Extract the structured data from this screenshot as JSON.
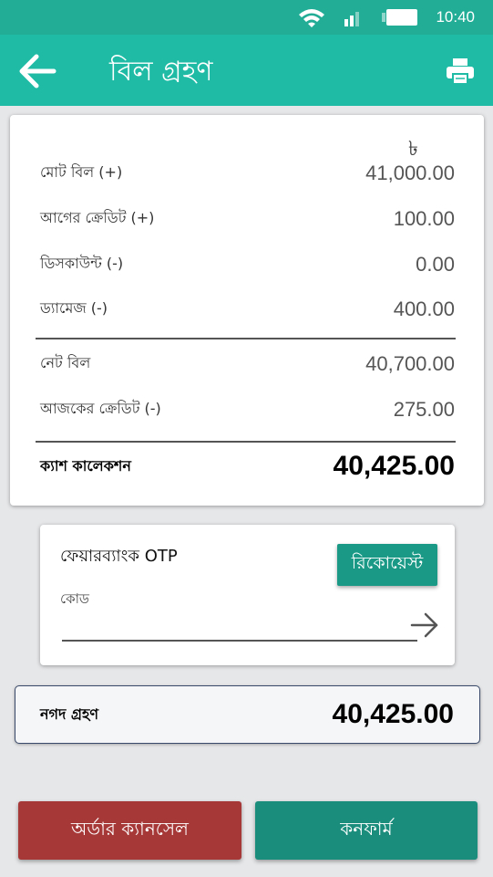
{
  "status_bar": {
    "time": "10:40",
    "icons": [
      "wifi-icon",
      "signal-icon",
      "battery-icon"
    ]
  },
  "app_bar": {
    "title": "বিল গ্রহণ",
    "back_icon": "arrow-left-icon",
    "print_icon": "printer-icon"
  },
  "bill": {
    "currency_symbol": "৳",
    "rows": [
      {
        "label": "মোট বিল (+)",
        "value": "41,000.00"
      },
      {
        "label": "আগের ক্রেডিট (+)",
        "value": "100.00"
      },
      {
        "label": "ডিসকাউন্ট (-)",
        "value": "0.00"
      },
      {
        "label": "ড্যামেজ (-)",
        "value": "400.00"
      },
      {
        "label": "নেট বিল",
        "value": "40,700.00"
      },
      {
        "label": "আজকের ক্রেডিট (-)",
        "value": "275.00"
      }
    ],
    "total": {
      "label": "ক্যাশ কালেকশন",
      "value": "40,425.00"
    }
  },
  "otp": {
    "title": "ফেয়ারব্যাংক OTP",
    "request_label": "রিকোয়েস্ট",
    "code_label": "কোড",
    "code_value": "",
    "submit_icon": "arrow-right-icon"
  },
  "cash_received": {
    "label": "নগদ গ্রহণ",
    "value": "40,425.00"
  },
  "actions": {
    "cancel_label": "অর্ডার ক্যানসেল",
    "confirm_label": "কনফার্ম"
  },
  "colors": {
    "primary": "#1fbba5",
    "status_bar": "#22ad96",
    "accent_button": "#1a9a86",
    "cancel": "#a73838",
    "confirm": "#1a8d7c"
  }
}
